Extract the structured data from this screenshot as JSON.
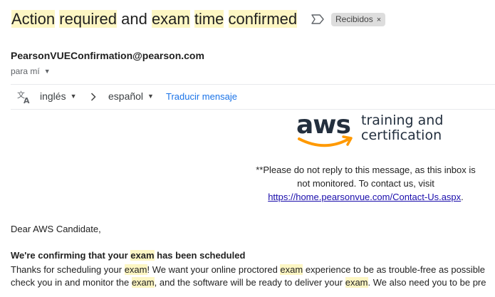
{
  "email": {
    "subject_parts": [
      "Action",
      " ",
      "required",
      " and ",
      "exam",
      " ",
      "time",
      " ",
      "confirmed"
    ],
    "label_chip": "Recibidos",
    "label_remove": "×",
    "sender": "PearsonVUEConfirmation@pearson.com",
    "recipient": "para mí"
  },
  "translate": {
    "from_language": "inglés",
    "to_language": "español",
    "action": "Traducir mensaje"
  },
  "logo": {
    "wordmark": "aws",
    "tagline_line1": "training and",
    "tagline_line2": "certification",
    "brand_color": "#232f3e",
    "smile_color": "#ff9900"
  },
  "notice": {
    "line1": "**Please do not reply to this message, as this inbox is",
    "line2": "not monitored. To contact us, visit",
    "link": "https://home.pearsonvue.com/Contact-Us.aspx",
    "after_link": "."
  },
  "body": {
    "greeting": "Dear AWS Candidate,",
    "headline_before": "We're confirming that your ",
    "headline_hl": "exam",
    "headline_after": " has been scheduled",
    "para1": [
      "Thanks for scheduling your ",
      "exam",
      "! We want your online proctored ",
      "exam",
      " experience to be as trouble-free as possible"
    ],
    "para2": [
      "check you in and monitor the ",
      "exam",
      ", and the software will be ready to deliver your ",
      "exam",
      ". We also need you to be pre"
    ]
  },
  "highlight_color": "#fdf6c3"
}
